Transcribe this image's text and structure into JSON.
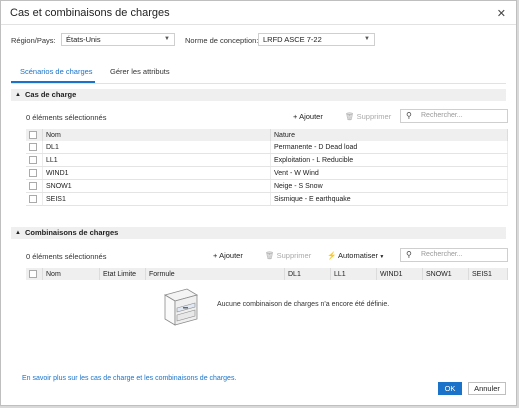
{
  "dialog": {
    "title": "Cas et combinaisons de charges"
  },
  "region": {
    "label": "Région/Pays:",
    "value": "États-Unis"
  },
  "norm": {
    "label": "Norme de conception:",
    "value": "LRFD ASCE 7-22"
  },
  "tabs": [
    {
      "label": "Scénarios de charges",
      "active": true
    },
    {
      "label": "Gérer les attributs",
      "active": false
    }
  ],
  "load_cases": {
    "title": "Cas de charge",
    "count": "0 éléments sélectionnés",
    "add_label": "Ajouter",
    "delete_label": "Supprimer",
    "search_placeholder": "Rechercher...",
    "columns": [
      "Nom",
      "Nature"
    ],
    "rows": [
      {
        "name": "DL1",
        "nature": "Permanente - D Dead load"
      },
      {
        "name": "LL1",
        "nature": "Exploitation - L Reducible"
      },
      {
        "name": "WIND1",
        "nature": "Vent - W Wind"
      },
      {
        "name": "SNOW1",
        "nature": "Neige - S Snow"
      },
      {
        "name": "SEIS1",
        "nature": "Sismique - E earthquake"
      }
    ]
  },
  "combinations": {
    "title": "Combinaisons de charges",
    "count": "0 éléments sélectionnés",
    "add_label": "Ajouter",
    "delete_label": "Supprimer",
    "automate_label": "Automatiser",
    "search_placeholder": "Rechercher...",
    "columns": [
      "Nom",
      "Etat Limite",
      "Formule",
      "DL1",
      "LL1",
      "WIND1",
      "SNOW1",
      "SEIS1"
    ],
    "empty_message": "Aucune combinaison de charges n'a encore été définie."
  },
  "footer": {
    "link": "En savoir plus sur les cas de charge et les combinaisons de charges.",
    "ok": "OK",
    "cancel": "Annuler"
  },
  "colors": {
    "accent": "#1a73c9"
  }
}
